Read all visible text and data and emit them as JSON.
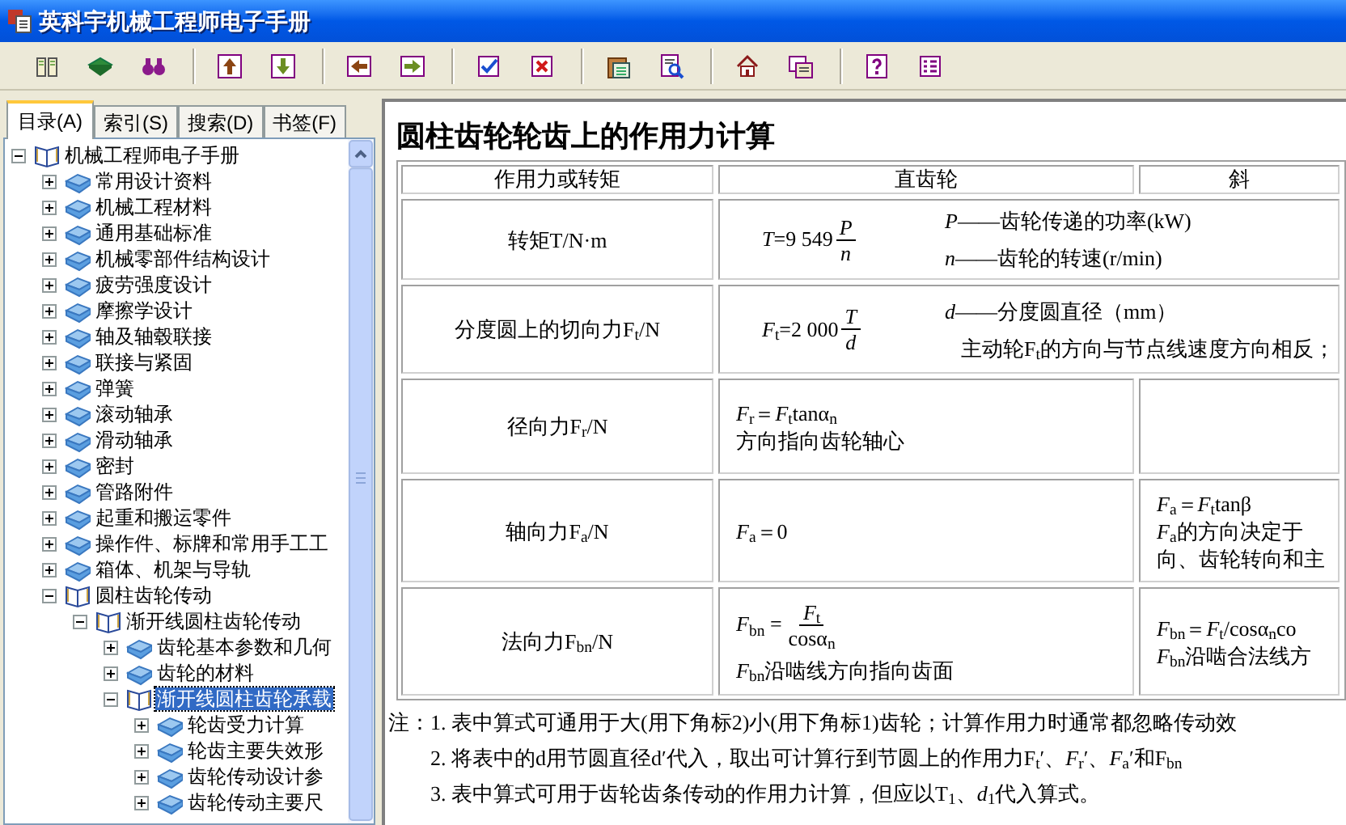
{
  "window": {
    "title": "英科宇机械工程师电子手册"
  },
  "nav_tabs": [
    {
      "label": "目录(A)",
      "selected": true
    },
    {
      "label": "索引(S)",
      "selected": false
    },
    {
      "label": "搜索(D)",
      "selected": false
    },
    {
      "label": "书签(F)",
      "selected": false
    }
  ],
  "tree": [
    {
      "label": "机械工程师电子手册",
      "expanded": true,
      "selected": false,
      "children": [
        {
          "label": "常用设计资料",
          "expanded": false,
          "selected": false
        },
        {
          "label": "机械工程材料",
          "expanded": false,
          "selected": false
        },
        {
          "label": "通用基础标准",
          "expanded": false,
          "selected": false
        },
        {
          "label": "机械零部件结构设计",
          "expanded": false,
          "selected": false
        },
        {
          "label": "疲劳强度设计",
          "expanded": false,
          "selected": false
        },
        {
          "label": "摩擦学设计",
          "expanded": false,
          "selected": false
        },
        {
          "label": "轴及轴毂联接",
          "expanded": false,
          "selected": false
        },
        {
          "label": "联接与紧固",
          "expanded": false,
          "selected": false
        },
        {
          "label": "弹簧",
          "expanded": false,
          "selected": false
        },
        {
          "label": "滚动轴承",
          "expanded": false,
          "selected": false
        },
        {
          "label": "滑动轴承",
          "expanded": false,
          "selected": false
        },
        {
          "label": "密封",
          "expanded": false,
          "selected": false
        },
        {
          "label": "管路附件",
          "expanded": false,
          "selected": false
        },
        {
          "label": "起重和搬运零件",
          "expanded": false,
          "selected": false
        },
        {
          "label": "操作件、标牌和常用手工工",
          "expanded": false,
          "selected": false
        },
        {
          "label": "箱体、机架与导轨",
          "expanded": false,
          "selected": false
        },
        {
          "label": "圆柱齿轮传动",
          "expanded": true,
          "selected": false,
          "children": [
            {
              "label": "渐开线圆柱齿轮传动",
              "expanded": true,
              "selected": false,
              "children": [
                {
                  "label": "齿轮基本参数和几何",
                  "expanded": false,
                  "selected": false
                },
                {
                  "label": "齿轮的材料",
                  "expanded": false,
                  "selected": false
                },
                {
                  "label": "渐开线圆柱齿轮承载",
                  "expanded": true,
                  "selected": true,
                  "children": [
                    {
                      "label": "轮齿受力计算",
                      "expanded": false,
                      "selected": false
                    },
                    {
                      "label": "轮齿主要失效形",
                      "expanded": false,
                      "selected": false
                    },
                    {
                      "label": "齿轮传动设计参",
                      "expanded": false,
                      "selected": false
                    },
                    {
                      "label": "齿轮传动主要尺",
                      "expanded": false,
                      "selected": false
                    }
                  ]
                }
              ]
            }
          ]
        }
      ]
    }
  ],
  "content": {
    "title": "圆柱齿轮轮齿上的作用力计算",
    "table": {
      "columns": [
        "作用力或转矩",
        "直齿轮",
        "斜"
      ],
      "rows": [
        {
          "cells": [
            {
              "kind": "label",
              "text": "转矩T/N·m"
            },
            {
              "kind": "fraction_with_notes",
              "lhs": "*T*=9 549",
              "numerator": "*P*",
              "denominator": "*n*",
              "notes": [
                "*P*——齿轮传递的功率(kW)",
                "*n*——齿轮的转速(r/min)"
              ]
            }
          ]
        },
        {
          "cells": [
            {
              "kind": "label",
              "text": "分度圆上的切向力F$_{t}$/N"
            },
            {
              "kind": "fraction_with_notes",
              "lhs": "*F*$_{t}$=2 000",
              "numerator": "*T*",
              "denominator": "*d*",
              "notes": [
                "*d*——分度圆直径（mm）",
                "主动轮F$_{t}$的方向与节点线速度方向相反；"
              ]
            }
          ]
        },
        {
          "cells": [
            {
              "kind": "label",
              "text": "径向力F$_{r}$/N"
            },
            {
              "kind": "lines",
              "lines": [
                "*F*$_{r}$＝*F*$_{t}$tanα$_{n}$",
                "方向指向齿轮轴心"
              ]
            },
            {
              "kind": "empty"
            }
          ]
        },
        {
          "cells": [
            {
              "kind": "label",
              "text": "轴向力F$_{a}$/N"
            },
            {
              "kind": "lines",
              "lines": [
                "*F*$_{a}$＝0"
              ]
            },
            {
              "kind": "lines",
              "lines": [
                "*F*$_{a}$＝*F*$_{t}$tanβ",
                "*F*$_{a}$的方向决定于",
                "向、齿轮转向和主"
              ]
            }
          ]
        },
        {
          "cells": [
            {
              "kind": "label",
              "text": "法向力F$_{bn}$/N"
            },
            {
              "kind": "fraction_lines",
              "lhs": "*F*$_{bn}$ =",
              "numerator": "*F*$_{t}$",
              "denominator": "cosα$_{n}$",
              "lines": [
                "*F*$_{bn}$沿啮线方向指向齿面"
              ]
            },
            {
              "kind": "lines",
              "lines": [
                "*F*$_{bn}$＝*F*$_{t}$/cosα$_{n}$co",
                "*F*$_{bn}$沿啮合法线方"
              ]
            }
          ]
        }
      ]
    },
    "notes": {
      "label": "注：",
      "items": [
        "1. 表中算式可通用于大(用下角标2)小(用下角标1)齿轮；计算作用力时通常都忽略传动效",
        "2. 将表中的d用节圆直径d′代入，取出可计算行到节圆上的作用力F$_{t}$′、*F*$_{r}$′、*F*$_{a}$′和F$_{bn}$",
        "3. 表中算式可用于齿轮齿条传动的作用力计算，但应以T$_{1}$、*d*$_{1}$代入算式。"
      ]
    }
  }
}
